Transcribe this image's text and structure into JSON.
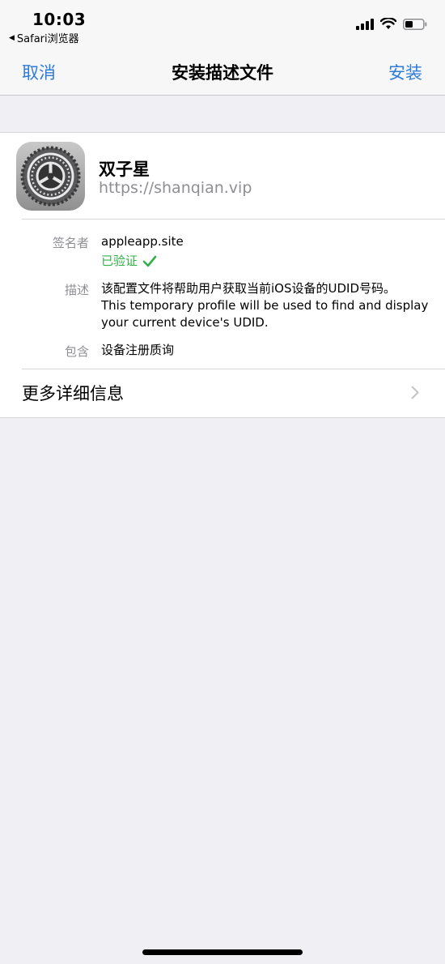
{
  "status_bar": {
    "time": "10:03",
    "back_app": "Safari浏览器"
  },
  "nav": {
    "cancel_label": "取消",
    "title": "安装描述文件",
    "install_label": "安装"
  },
  "profile": {
    "name": "双子星",
    "url": "https://shanqian.vip",
    "icon": "settings-gear-icon"
  },
  "details": {
    "signer_label": "签名者",
    "signer_value": "appleapp.site",
    "verified_text": "已验证",
    "description_label": "描述",
    "description_lines": [
      "该配置文件将帮助用户获取当前iOS设备的UDID号码。",
      "This temporary profile will be used to find and display",
      "your current device's UDID."
    ],
    "contains_label": "包含",
    "contains_value": "设备注册质询"
  },
  "more_info_label": "更多详细信息",
  "colors": {
    "accent": "#2f7bd8",
    "verified": "#34b04a",
    "secondary_text": "#8e8e93",
    "background": "#efeff4"
  }
}
